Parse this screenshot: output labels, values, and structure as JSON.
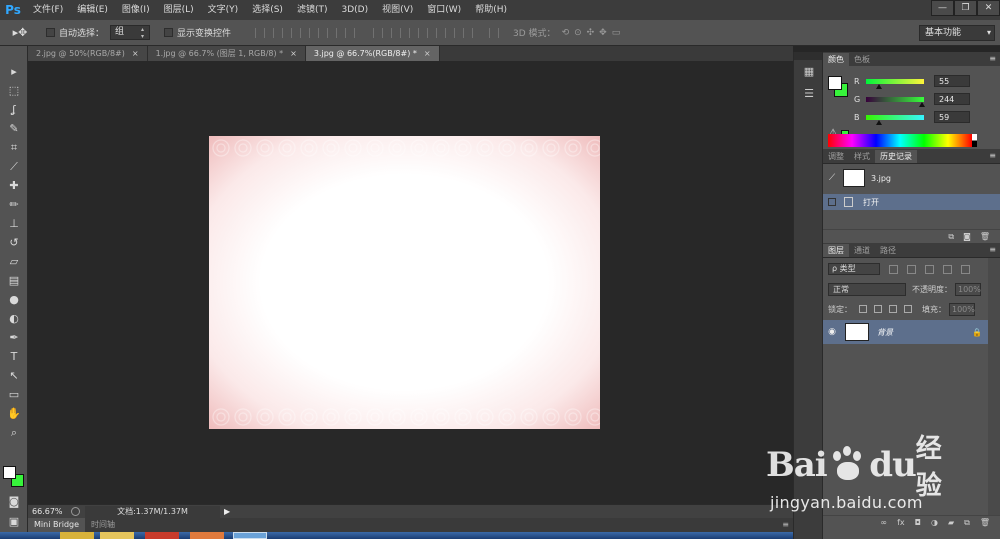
{
  "app": {
    "logo": "Ps",
    "menu": [
      "文件(F)",
      "编辑(E)",
      "图像(I)",
      "图层(L)",
      "文字(Y)",
      "选择(S)",
      "滤镜(T)",
      "3D(D)",
      "视图(V)",
      "窗口(W)",
      "帮助(H)"
    ],
    "window_buttons": {
      "minimize": "—",
      "restore": "❐",
      "close": "✕"
    }
  },
  "options_bar": {
    "auto_select_label": "自动选择：",
    "auto_select_value": "组",
    "show_transform_label": "显示变换控件",
    "mode_3d_label": "3D 模式：",
    "workspace": "基本功能"
  },
  "tabs": [
    {
      "label": "2.jpg @ 50%(RGB/8#)",
      "close": "×",
      "active": false
    },
    {
      "label": "1.jpg @ 66.7% (图层 1, RGB/8) *",
      "close": "×",
      "active": false
    },
    {
      "label": "3.jpg @ 66.7%(RGB/8#) *",
      "close": "×",
      "active": true
    }
  ],
  "status": {
    "zoom": "66.67%",
    "doc_info": "文档:1.37M/1.37M",
    "arrow": "▶"
  },
  "bottom_panel": {
    "tabs": [
      "Mini Bridge",
      "时间轴"
    ],
    "menu": "≡"
  },
  "color_panel": {
    "tabs": [
      "颜色",
      "色板"
    ],
    "menu": "≡",
    "foreground": "#ffffff",
    "background": "#37f43b",
    "r": {
      "label": "R",
      "value": "55"
    },
    "g": {
      "label": "G",
      "value": "244"
    },
    "b": {
      "label": "B",
      "value": "59"
    },
    "r_level": 0.216,
    "g_level": 0.957,
    "b_level": 0.231,
    "warning_icon": "⚠"
  },
  "history_panel": {
    "tabs": [
      "调整",
      "样式",
      "历史记录"
    ],
    "menu": "≡",
    "snapshot_name": "3.jpg",
    "step_label": "打开"
  },
  "layers_panel": {
    "tabs": [
      "图层",
      "通道",
      "路径"
    ],
    "menu": "≡",
    "filter_type": "ρ 类型",
    "blend_mode": "正常",
    "opacity_label": "不透明度：",
    "opacity_value": "100%",
    "lock_label": "锁定：",
    "fill_label": "填充：",
    "fill_value": "100%",
    "layer_name": "背景"
  },
  "watermark": {
    "bai": "Bai",
    "du": "du",
    "cn": "经验",
    "url": "jingyan.baidu.com"
  },
  "colors": {
    "accent_blue": "#31a8ff",
    "selection": "#5d6f8c",
    "panel_bg": "#535353"
  }
}
